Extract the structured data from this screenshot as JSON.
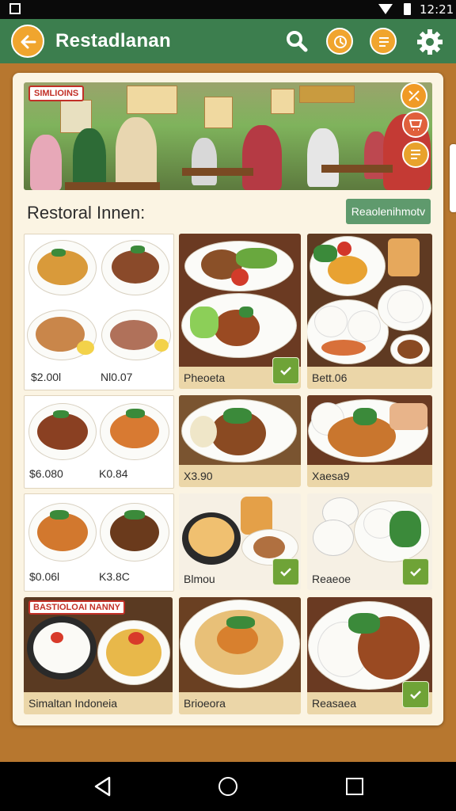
{
  "status_bar": {
    "time": "12:21"
  },
  "app_bar": {
    "title": "Restadlanan"
  },
  "hero": {
    "badge": "SIMLIOINS"
  },
  "section": {
    "title": "Restoral Innen:",
    "button": "Reaolenihmotv"
  },
  "menu": {
    "row1": {
      "left_price1": "$2.00l",
      "left_price2": "Nl0.07",
      "mid_caption": "Pheoeta",
      "right_caption": "Bett.06"
    },
    "row2": {
      "left_price1": "$6.080",
      "left_price2": "K0.84",
      "mid_caption": "X3.90",
      "right_caption": "Xaesa9"
    },
    "row3": {
      "left_price1": "$0.06l",
      "left_price2": "K3.8C",
      "mid_caption": "Blmou",
      "right_caption": "Reaeoe"
    },
    "row4": {
      "left_badge": "BASTIOLOAI NANNY",
      "left_caption": "Simaltan Indoneia",
      "mid_caption": "Brioeora",
      "right_caption": "Reasaea"
    }
  },
  "colors": {
    "app_bar": "#3c7e4e",
    "accent": "#f0a52e",
    "panel": "#fbf4e3",
    "background": "#b7772f",
    "check": "#6fa337"
  },
  "icons": [
    "back-arrow-icon",
    "search-icon",
    "clock-icon",
    "menu-list-icon",
    "gear-icon",
    "check-icon",
    "home-icon",
    "recent-apps-icon"
  ]
}
